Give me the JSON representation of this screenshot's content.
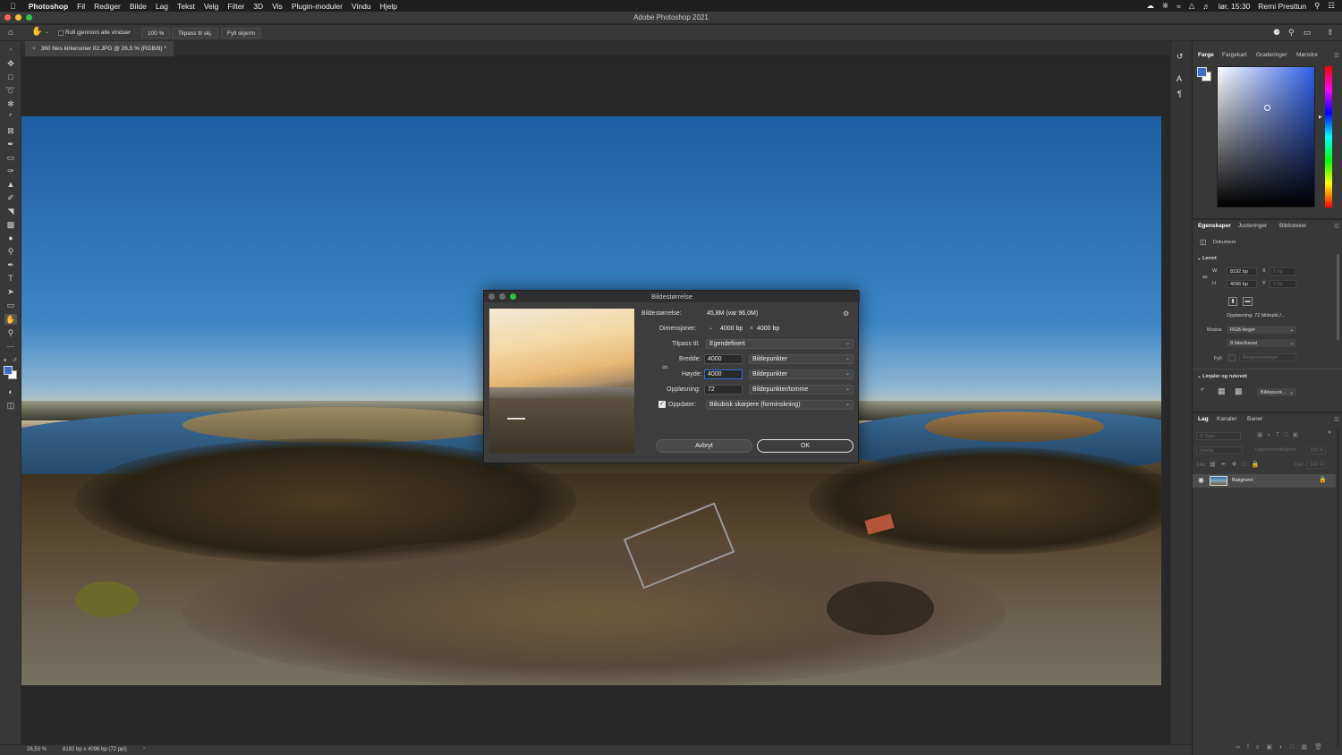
{
  "menubar": {
    "app_name": "Photoshop",
    "items": [
      "Fil",
      "Rediger",
      "Bilde",
      "Lag",
      "Tekst",
      "Velg",
      "Filter",
      "3D",
      "Vis",
      "Plugin-moduler",
      "Vindu",
      "Hjelp"
    ],
    "datetime": "lør. 15:30",
    "user": "Remi Presttun"
  },
  "window": {
    "title": "Adobe Photoshop 2021"
  },
  "options_bar": {
    "scroll_all_label": "Rull gjennom alle vinduer",
    "zoom_100": "100 %",
    "fit_screen": "Tilpass til skj.",
    "fill_screen": "Fyll skjerm"
  },
  "document": {
    "tab_title": "360 Nes kirkeruiner 02.JPG @ 26,5 % (RGB/8) *"
  },
  "status": {
    "zoom": "26,53 %",
    "info": "8192 bp x 4096 bp (72 ppi)"
  },
  "color_panel": {
    "tabs": [
      "Farge",
      "Fargekart",
      "Graderinger",
      "Mønstre"
    ],
    "foreground": "#3a6fc8",
    "background": "#ffffff"
  },
  "properties_panel": {
    "tabs": [
      "Egenskaper",
      "Justeringer",
      "Biblioteker"
    ],
    "doc_label": "Dokument",
    "canvas_section": "Lerret",
    "w_label": "W",
    "w_value": "8192 bp",
    "h_label": "H",
    "h_value": "4096 bp",
    "x_label": "X",
    "x_value": "0 bp",
    "y_label": "Y",
    "y_value": "0 bp",
    "resolution": "Oppløsning: 72 bildepkt./...",
    "mode_label": "Modus",
    "mode_value": "RGB-farger",
    "bits_value": "8 biter/kanal",
    "fill_label": "Fyll",
    "fill_value": "Bakgrunnsfarge",
    "guides_section": "Linjaler og rutenett",
    "guides_unit": "Bildepunk..."
  },
  "layers_panel": {
    "tabs": [
      "Lag",
      "Kanaler",
      "Baner"
    ],
    "search_placeholder": "Type",
    "blend_mode": "Vanlig",
    "opacity_label": "Ugjennomsiktighet:",
    "opacity_value": "100 %",
    "lock_label": "Lås:",
    "fill_label": "Fyll:",
    "fill_value": "100 %",
    "layers": [
      {
        "name": "Bakgrunn"
      }
    ]
  },
  "dialog": {
    "title": "Bildestørrelse",
    "size_label": "Bildestørrelse:",
    "size_value": "45,8M (var 96,0M)",
    "dims_label": "Dimensjoner:",
    "dims_w": "4000 bp",
    "dims_x": "×",
    "dims_h": "4000 bp",
    "fit_label": "Tilpass til:",
    "fit_value": "Egendefinert",
    "width_label": "Bredde:",
    "width_value": "4000",
    "width_unit": "Bildepunkter",
    "height_label": "Høyde:",
    "height_value": "4000",
    "height_unit": "Bildepunkter",
    "res_label": "Oppløsning:",
    "res_value": "72",
    "res_unit": "Bildepunkter/tomme",
    "resample_label": "Oppdater:",
    "resample_checked": true,
    "resample_value": "Bikubisk skarpere (forminskning)",
    "cancel": "Avbryt",
    "ok": "OK"
  }
}
